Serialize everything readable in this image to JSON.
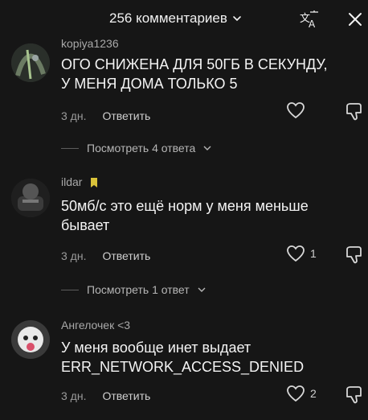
{
  "header": {
    "title": "256 комментариев",
    "icons": {
      "dropdown": "chevron-down-icon",
      "translate": "translate-icon",
      "close": "close-icon"
    }
  },
  "comments": [
    {
      "username": "kopiya1236",
      "text_lines": [
        "ОГО СНИЖЕНА ДЛЯ 50ГБ В СЕКУНДУ,",
        "У МЕНЯ ДОМА ТОЛЬКО 5"
      ],
      "age": "3 дн.",
      "reply_label": "Ответить",
      "like_count": "",
      "replies_label": "Посмотреть 4 ответа"
    },
    {
      "username": "ildar",
      "badge": "yellow-sticker",
      "text_lines": [
        "50мб/с это ещё норм у меня меньше",
        "бывает"
      ],
      "age": "3 дн.",
      "reply_label": "Ответить",
      "like_count": "1",
      "replies_label": "Посмотреть 1 ответ"
    },
    {
      "username": "Ангелочек <3",
      "text_lines": [
        "У меня вообще инет выдает",
        "ERR_NETWORK_ACCESS_DENIED"
      ],
      "age": "3 дн.",
      "reply_label": "Ответить",
      "like_count": "2"
    }
  ],
  "colors": {
    "background": "#161616",
    "text": "#f4f4f4",
    "muted": "#9b9b9b"
  }
}
